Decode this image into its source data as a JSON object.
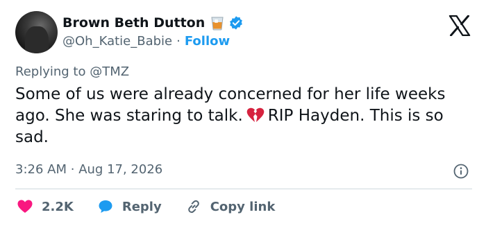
{
  "user": {
    "display_name": "Brown Beth Dutton",
    "handle": "@Oh_Katie_Babie",
    "separator": "·",
    "follow_label": "Follow"
  },
  "reply_context": {
    "prefix": "Replying to ",
    "mention": "@TMZ"
  },
  "tweet": {
    "text_before": "Some of us were already concerned for her life weeks ago. She was staring to talk.",
    "text_after": "RIP Hayden. This is so sad.",
    "emoji": "broken-heart"
  },
  "meta": {
    "time": "3:26 AM",
    "separator": "·",
    "date": "Aug 17, 2026"
  },
  "actions": {
    "likes": "2.2K",
    "reply": "Reply",
    "copy_link": "Copy link"
  },
  "icons": {
    "glass": "whiskey-glass-icon",
    "verified": "verified-badge-icon",
    "brand": "x-logo-icon",
    "info": "info-icon",
    "like": "heart-icon",
    "reply": "speech-bubble-icon",
    "copy": "link-icon"
  },
  "colors": {
    "accent": "#1d9bf0",
    "like": "#f91880",
    "text": "#0f1419",
    "muted": "#536471",
    "divider": "#cfd9de"
  }
}
